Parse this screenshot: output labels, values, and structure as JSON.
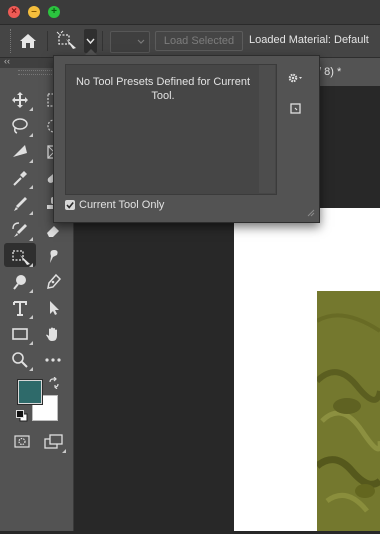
{
  "window": {
    "close_glyph": "×",
    "minimize_glyph": "–",
    "zoom_glyph": "+"
  },
  "options_bar": {
    "load_selected_label": "Load Selected",
    "loaded_material_text": "Loaded Material: Default"
  },
  "tools_panel": {
    "collapse_glyph": "‹‹",
    "foreground_color": "#2e6a6a",
    "background_color": "#ffffff"
  },
  "document": {
    "tab_title": "/ 8) *"
  },
  "preset_popup": {
    "empty_message": "No Tool Presets Defined for Current Tool.",
    "current_tool_only_label": "Current Tool Only",
    "current_tool_only_checked": true
  },
  "colors": {
    "accent_red": "#ee5b55",
    "accent_yellow": "#f5be3c",
    "accent_green": "#2bc43f",
    "panel": "#535353",
    "canvas_photo": "#74782e"
  }
}
